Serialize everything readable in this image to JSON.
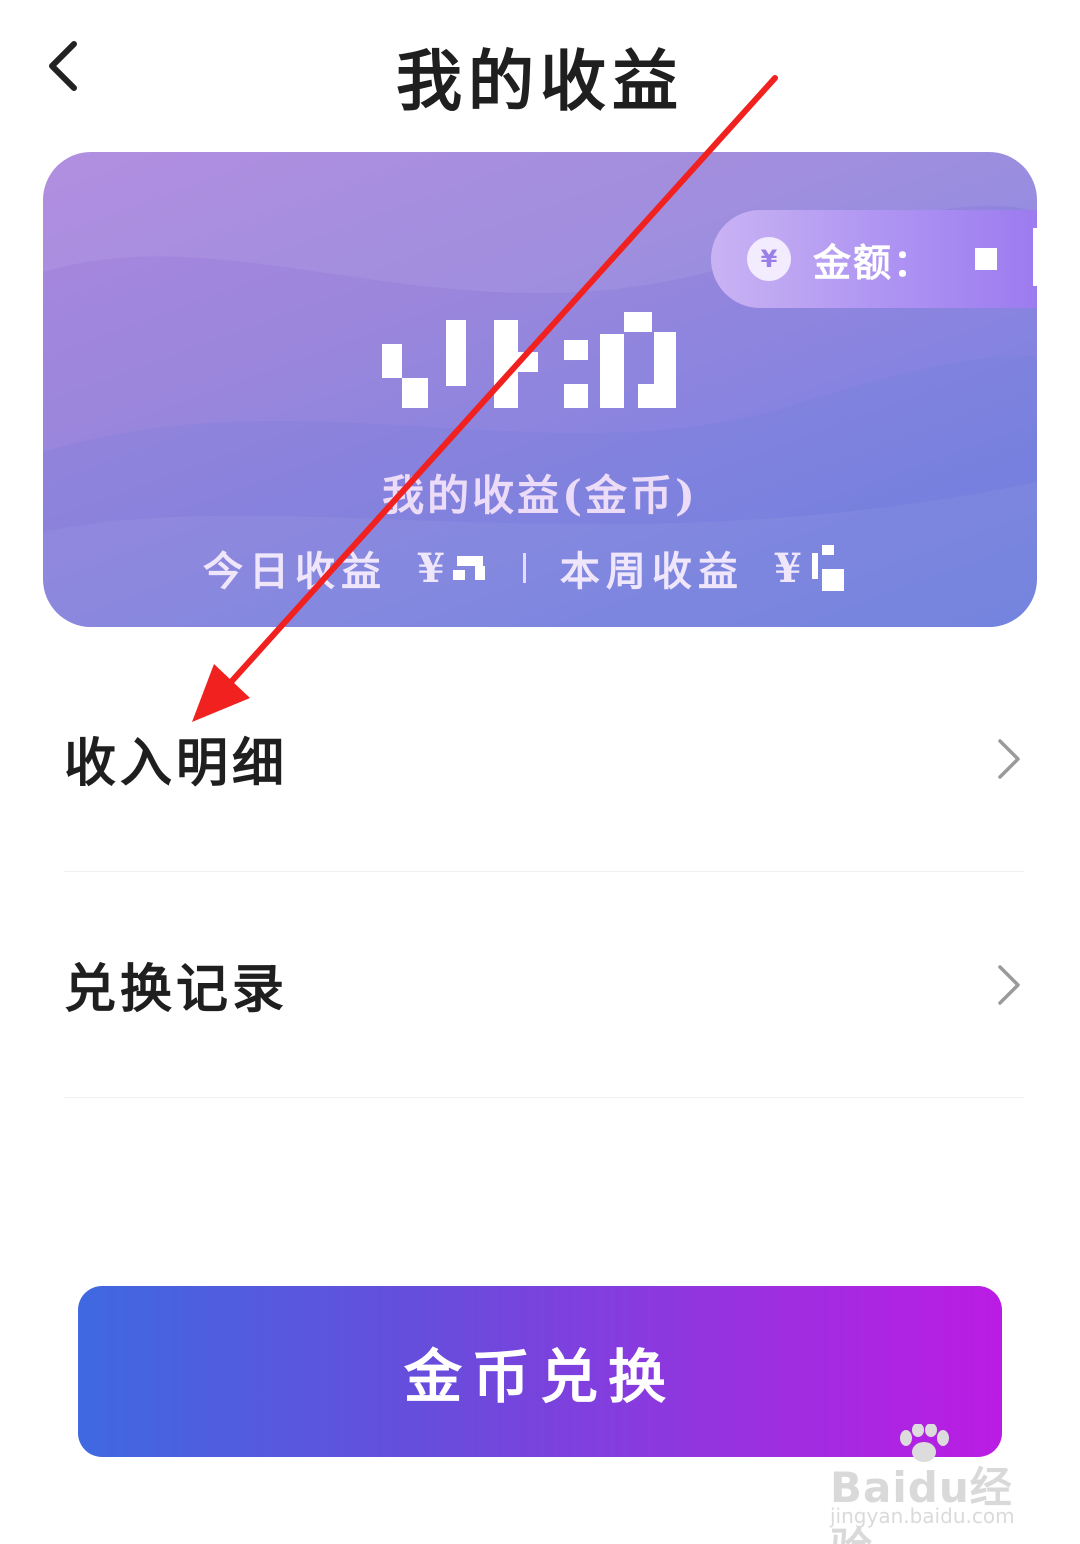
{
  "header": {
    "title": "我的收益",
    "back_icon": "chevron-left-icon"
  },
  "earnings_card": {
    "amount_label": "金额：",
    "yen_symbol": "¥",
    "caption": "我的收益(金币)",
    "today_label": "今日收益",
    "today_value": "¥",
    "week_label": "本周收益",
    "week_value": "¥",
    "gradient_colors": [
      "#ac86de",
      "#8584e0",
      "#6f80df"
    ]
  },
  "menu": {
    "items": [
      {
        "label": "收入明细",
        "icon": "chevron-right-icon"
      },
      {
        "label": "兑换记录",
        "icon": "chevron-right-icon"
      }
    ]
  },
  "exchange_button": {
    "label": "金币兑换",
    "gradient_colors": [
      "#3f69e0",
      "#6a4bdc",
      "#bb1ce3"
    ]
  },
  "annotation": {
    "color": "#f0211f",
    "icon": "red-arrow-annotation"
  },
  "watermark": {
    "brand": "Baidu经验",
    "url": "jingyan.baidu.com"
  }
}
